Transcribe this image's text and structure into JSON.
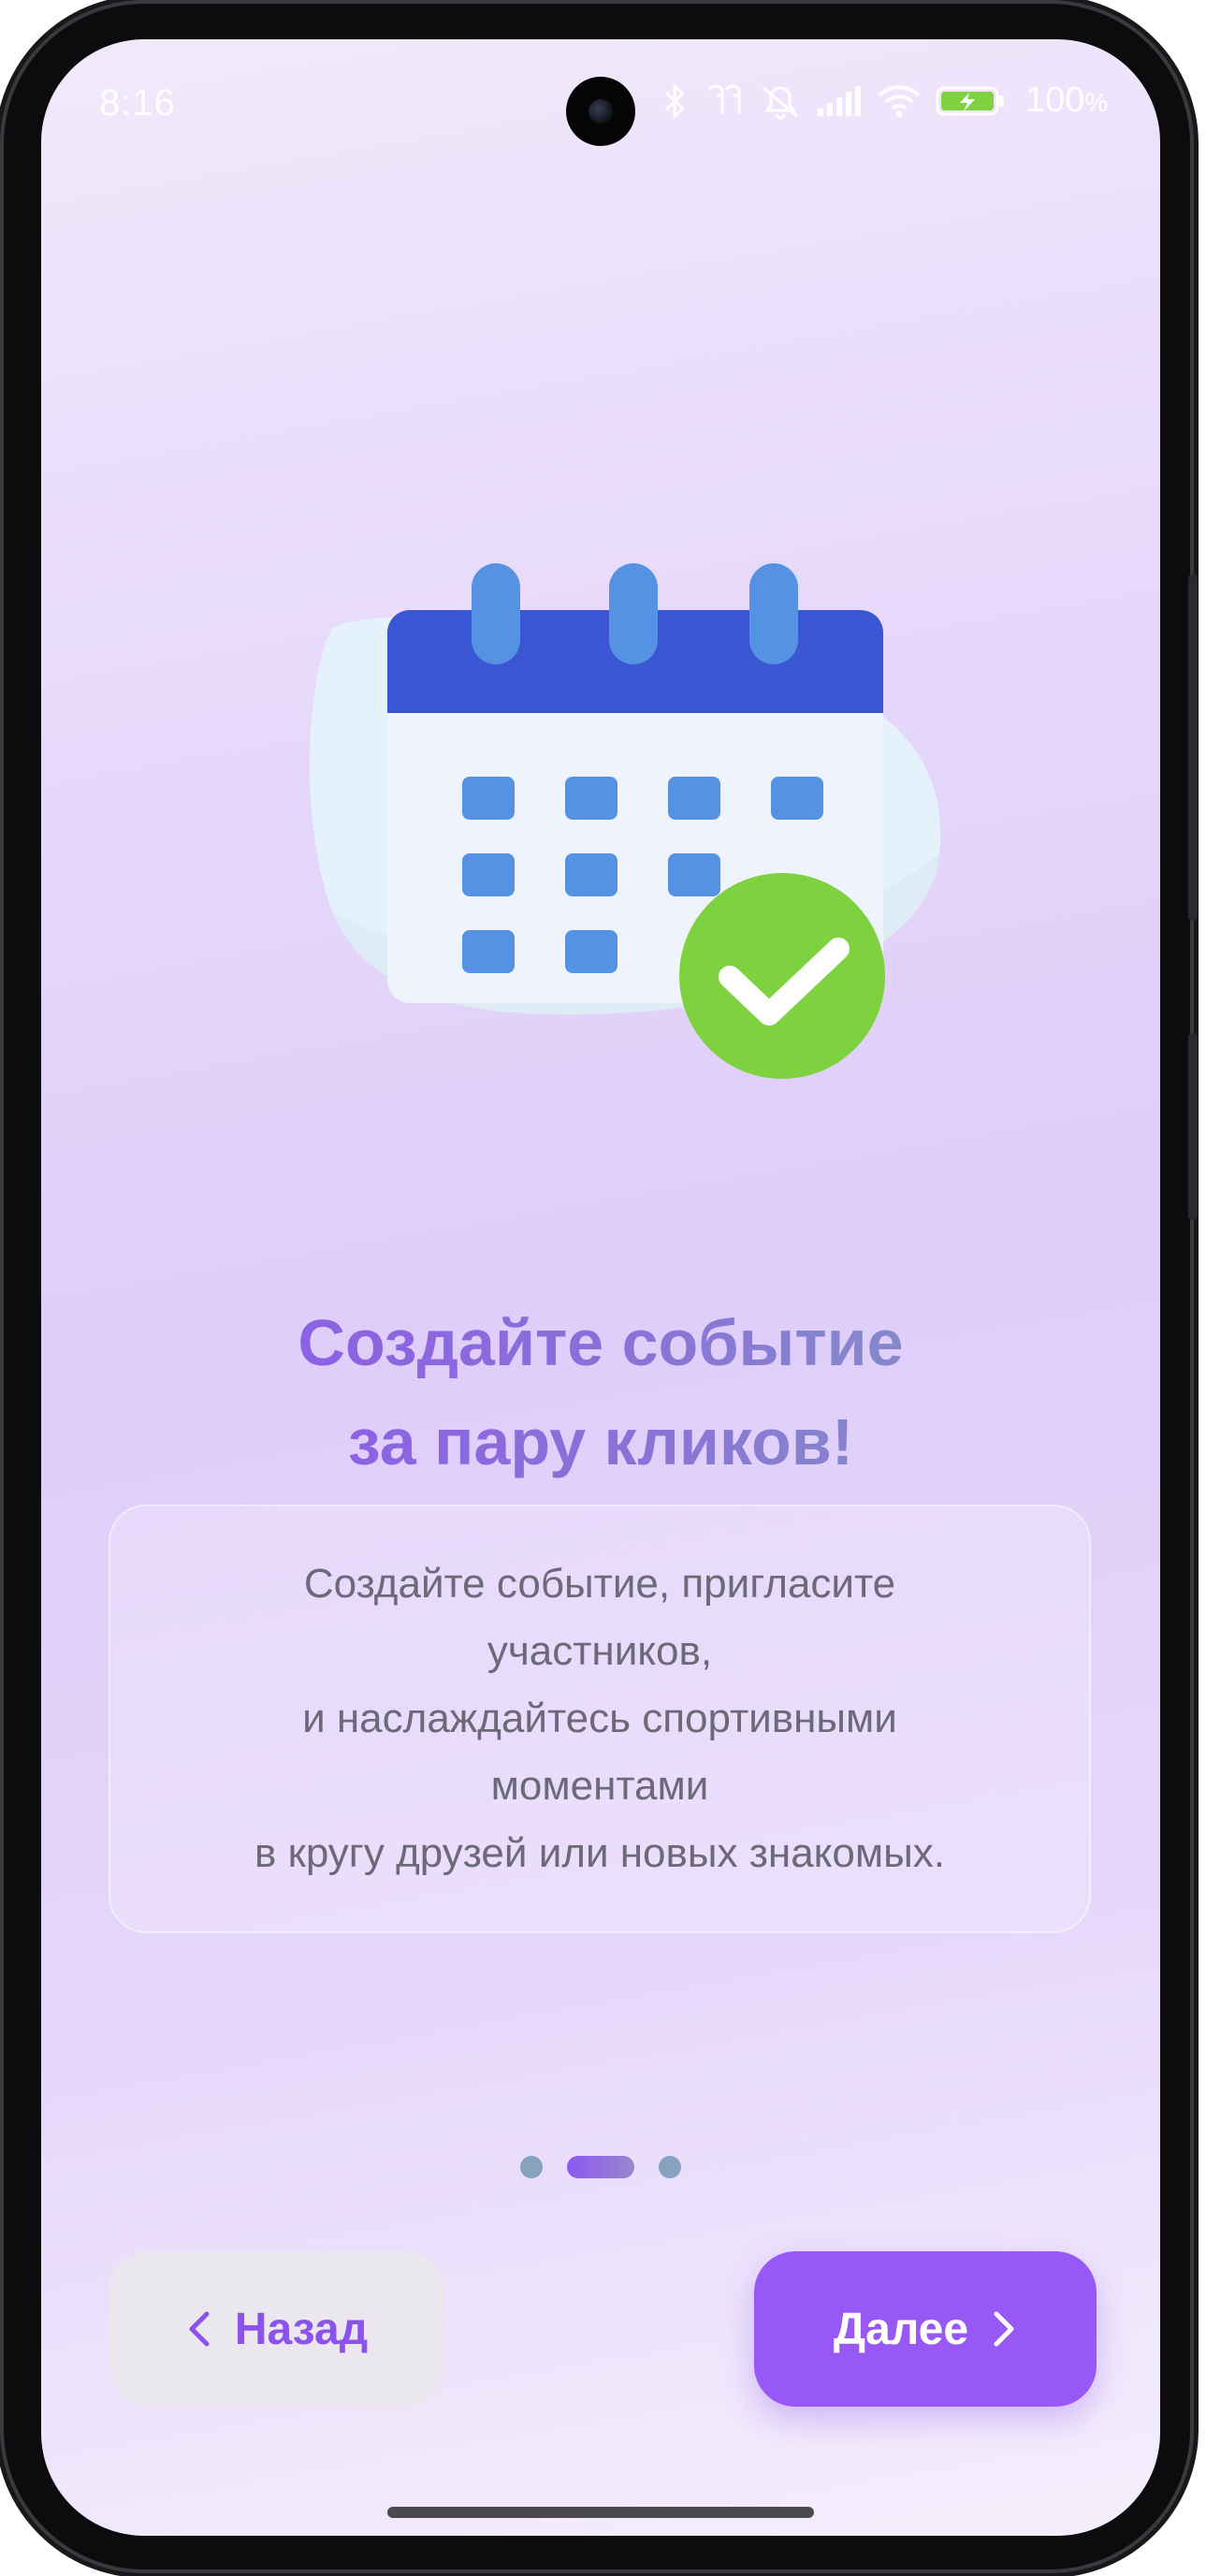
{
  "status_bar": {
    "time": "8:16",
    "battery_value": "100",
    "battery_unit": "%",
    "icons": [
      "camera-hole",
      "bluetooth-icon",
      "earbuds-icon",
      "mute-icon",
      "signal-icon",
      "wifi-icon",
      "battery-charging-icon"
    ]
  },
  "onboarding": {
    "illustration": "calendar-check-icon",
    "title_lines": [
      "Создайте событие",
      "за пару кликов!"
    ],
    "description_lines": [
      "Создайте событие, пригласите",
      "участников,",
      "и наслаждайтесь спортивными",
      "моментами",
      "в кругу друзей или новых знакомых."
    ],
    "pagination": {
      "total": 3,
      "active_index": 1
    }
  },
  "buttons": {
    "back_label": "Назад",
    "next_label": "Далее"
  },
  "colors": {
    "accent": "#9858f6",
    "calendar_header": "#3a56d4",
    "calendar_cell": "#5592e3",
    "check_green": "#7fd23f",
    "text_muted": "#6b6a78"
  }
}
